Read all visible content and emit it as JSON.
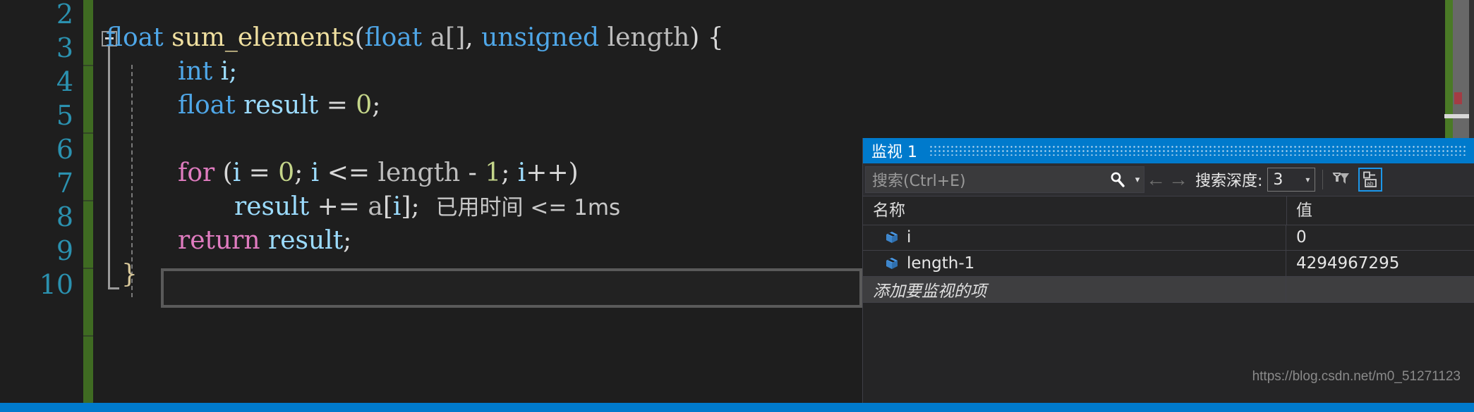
{
  "editor": {
    "line_numbers": [
      "2",
      "3",
      "4",
      "5",
      "6",
      "7",
      "8",
      "9",
      "10"
    ],
    "lines": [
      {
        "number": "2",
        "text": ""
      },
      {
        "number": "3",
        "text": "float sum_elements(float a[], unsigned length) {"
      },
      {
        "number": "4",
        "text": "    int i;"
      },
      {
        "number": "5",
        "text": "    float result = 0;"
      },
      {
        "number": "6",
        "text": ""
      },
      {
        "number": "7",
        "text": "    for (i = 0; i <= length - 1; i++)"
      },
      {
        "number": "8",
        "text": "        result += a[i];"
      },
      {
        "number": "9",
        "text": "    return result;"
      },
      {
        "number": "10",
        "text": "}"
      }
    ],
    "tokens": {
      "l3_type": "float",
      "l3_fn": "sum_elements",
      "l3_open": "(",
      "l3_ptype": "float",
      "l3_param1": "a[]",
      "l3_comma": ", ",
      "l3_ptype2": "unsigned",
      "l3_param2": "length",
      "l3_close": ") {",
      "l4_type": "int",
      "l4_var": "i;",
      "l5_type": "float",
      "l5_var": "result",
      "l5_eq": "= ",
      "l5_num": "0",
      "l5_semi": ";",
      "l7_for": "for",
      "l7_open": "(",
      "l7_i1": "i",
      "l7_eq": " = ",
      "l7_zero": "0",
      "l7_semi1": "; ",
      "l7_i2": "i",
      "l7_cmp": " <= ",
      "l7_len": "length",
      "l7_minus": " - ",
      "l7_one": "1",
      "l7_semi2": "; ",
      "l7_i3": "i",
      "l7_inc": "++)",
      "l8_result": "result",
      "l8_op": " += ",
      "l8_a": "a",
      "l8_brk1": "[",
      "l8_i": "i",
      "l8_brk2": "]",
      "l8_semi": ";",
      "l9_return": "return",
      "l9_result": " result",
      "l9_semi": ";",
      "l10_brace": "}"
    },
    "elapsed_annotation": "已用时间 <= 1ms",
    "collapse_icon": "collapse-minus-icon"
  },
  "watch": {
    "title": "监视 1",
    "search": {
      "placeholder": "搜索(Ctrl+E)",
      "value": "",
      "icon": "search-icon",
      "dropdown_caret": "▾"
    },
    "nav": {
      "back": "←",
      "forward": "→"
    },
    "depth": {
      "label": "搜索深度:",
      "value": "3",
      "caret": "▾"
    },
    "toolbar_icons": [
      {
        "name": "pin-filter-icon",
        "active": false
      },
      {
        "name": "hex-display-toggle-icon",
        "active": true,
        "glyph": "ab"
      }
    ],
    "columns": [
      "名称",
      "值"
    ],
    "rows": [
      {
        "icon": "local-variable-cube-icon",
        "name": "i",
        "value": "0"
      },
      {
        "icon": "local-variable-cube-icon",
        "name": "length-1",
        "value": "4294967295"
      }
    ],
    "add_row_placeholder": "添加要监视的项"
  },
  "scrollbar": {
    "change_marker_color": "#4a7a26",
    "error_marker_color": "#a33c44",
    "thumb_color": "#d8d8d8"
  },
  "watermark": "https://blog.csdn.net/m0_51271123",
  "colors": {
    "editor_background": "#1e1e1e",
    "accent": "#007acc",
    "line_number": "#2b91af",
    "type_keyword": "#4fa7e8",
    "control_keyword": "#e07cc0",
    "function_name": "#f0e0a0",
    "number_literal": "#c5d68a",
    "panel_background": "#252526"
  }
}
